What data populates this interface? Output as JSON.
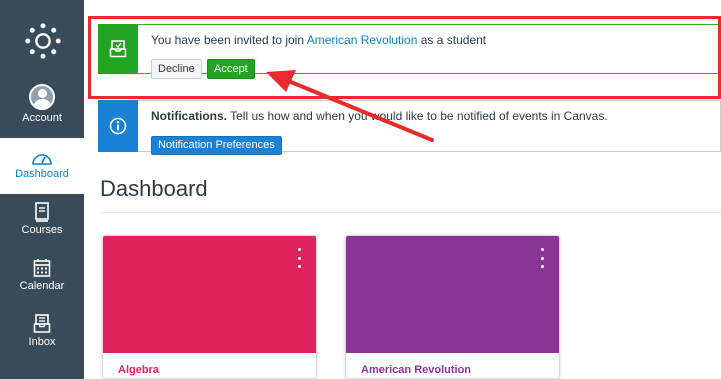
{
  "nav": {
    "account_label": "Account",
    "dashboard_label": "Dashboard",
    "courses_label": "Courses",
    "calendar_label": "Calendar",
    "inbox_label": "Inbox"
  },
  "invite_banner": {
    "text_before": "You have been invited to join ",
    "course_link": "American Revolution",
    "text_after": " as a student",
    "decline_label": "Decline",
    "accept_label": "Accept"
  },
  "notifications_banner": {
    "heading": "Notifications.",
    "message": " Tell us how and when you would like to be notified of events in Canvas.",
    "button_label": "Notification Preferences"
  },
  "page_title": "Dashboard",
  "courses": [
    {
      "name": "Algebra",
      "color": "#e0225d"
    },
    {
      "name": "American Revolution",
      "color": "#8b3596"
    }
  ],
  "colors": {
    "nav_bg": "#394b58",
    "accent_green": "#23a423",
    "accent_blue": "#1b81d4",
    "annotation_red": "#ea2b2b"
  }
}
